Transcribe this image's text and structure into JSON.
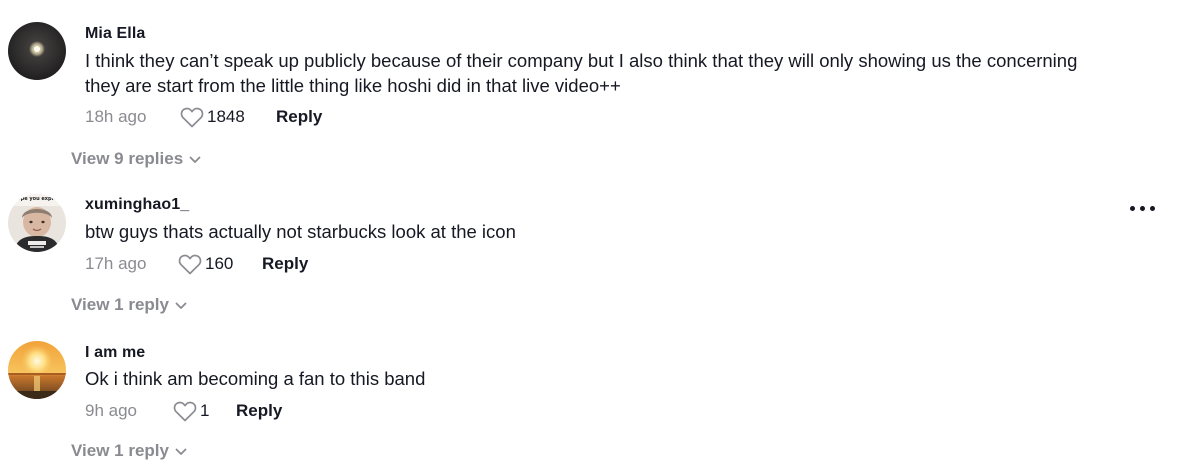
{
  "comments": [
    {
      "username": "Mia Ella",
      "text": "I think they can’t speak up publicly because of their company but I also think that they will only showing us the concerning they are start from the little thing like hoshi did in that live video++",
      "time": "18h ago",
      "likes": "1848",
      "reply_label": "Reply",
      "view_replies": "View 9 replies",
      "avatar": "moon-night-avatar"
    },
    {
      "username": "xuminghao1_",
      "text": "btw guys thats actually not starbucks look at the icon",
      "time": "17h ago",
      "likes": "160",
      "reply_label": "Reply",
      "view_replies": "View 1 reply",
      "avatar": "person-selfie-avatar",
      "avatar_caption": "..ope you explo.."
    },
    {
      "username": "I am me",
      "text": "Ok i think am becoming a fan to this band",
      "time": "9h ago",
      "likes": "1",
      "reply_label": "Reply",
      "view_replies": "View 1 reply",
      "avatar": "sunset-sea-avatar"
    }
  ],
  "icons": {
    "like": "heart-outline-icon",
    "expand": "chevron-down-icon",
    "more": "more-horizontal-icon"
  },
  "colors": {
    "primary_text": "#161823",
    "secondary_text": "#8a8b91"
  }
}
